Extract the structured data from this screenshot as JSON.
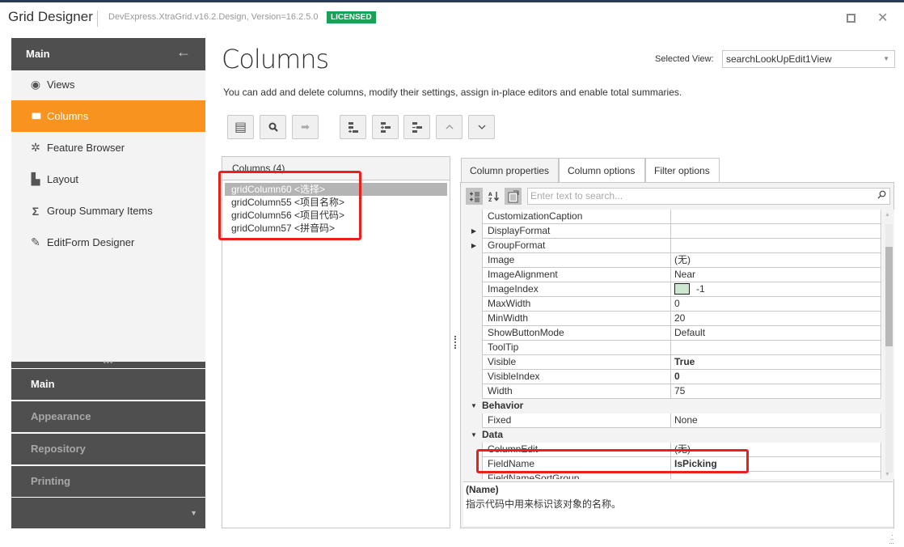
{
  "window": {
    "title": "Grid Designer",
    "version": "DevExpress.XtraGrid.v16.2.Design, Version=16.2.5.0",
    "license_badge": "LICENSED",
    "maximize_icon": "□",
    "close_icon": "✕"
  },
  "sidebar": {
    "header": "Main",
    "back_icon": "←",
    "items": [
      {
        "label": "Views",
        "icon": "eye-icon",
        "glyph": "◉"
      },
      {
        "label": "Columns",
        "icon": "columns-icon",
        "glyph": "▮▮▮",
        "active": true
      },
      {
        "label": "Feature Browser",
        "icon": "gear-icon",
        "glyph": "✲"
      },
      {
        "label": "Layout",
        "icon": "layout-icon",
        "glyph": "▙"
      },
      {
        "label": "Group Summary Items",
        "icon": "sigma-icon",
        "glyph": "Σ"
      },
      {
        "label": "EditForm Designer",
        "icon": "edit-form-icon",
        "glyph": "✎"
      }
    ],
    "splitter_dots": "•••",
    "nav_groups": [
      {
        "label": "Main",
        "current": true
      },
      {
        "label": "Appearance"
      },
      {
        "label": "Repository"
      },
      {
        "label": "Printing"
      }
    ],
    "more_arrow": "▼"
  },
  "main": {
    "title": "Columns",
    "selected_view_label": "Selected View:",
    "selected_view_value": "searchLookUpEdit1View",
    "dropdown_arrow": "▼",
    "description": "You can add and delete columns, modify their settings, assign in-place editors and enable total summaries.",
    "toolbar": [
      {
        "name": "column-list-button",
        "glyph": "▤"
      },
      {
        "name": "find-button",
        "glyph": "🔍︎",
        "alt": "⚲"
      },
      {
        "name": "retrieve-fields-button",
        "glyph": "➡",
        "disabled": true
      },
      {
        "name": "add-column-button",
        "glyph": "≛"
      },
      {
        "name": "insert-column-button",
        "glyph": "≛"
      },
      {
        "name": "remove-column-button",
        "glyph": "≡"
      },
      {
        "name": "move-up-button",
        "glyph": "⌃"
      },
      {
        "name": "move-down-button",
        "glyph": "⌄"
      }
    ]
  },
  "columns_list": {
    "header": "Columns (4)",
    "items": [
      {
        "label": "gridColumn60 <选择>",
        "selected": true
      },
      {
        "label": "gridColumn55 <项目名称>"
      },
      {
        "label": "gridColumn56 <项目代码>"
      },
      {
        "label": "gridColumn57 <拼音码>"
      }
    ]
  },
  "properties": {
    "tabs": [
      {
        "label": "Column properties",
        "active": true
      },
      {
        "label": "Column options"
      },
      {
        "label": "Filter options"
      }
    ],
    "search_placeholder": "Enter text to search...",
    "search_icon": "⌕",
    "rows": [
      {
        "name": "CustomizationCaption",
        "value": ""
      },
      {
        "name": "DisplayFormat",
        "value": "",
        "expandable": true
      },
      {
        "name": "GroupFormat",
        "value": "",
        "expandable": true
      },
      {
        "name": "Image",
        "value": "(无)"
      },
      {
        "name": "ImageAlignment",
        "value": "Near"
      },
      {
        "name": "ImageIndex",
        "value": "-1",
        "swatch_color": "#cce8cf"
      },
      {
        "name": "MaxWidth",
        "value": "0"
      },
      {
        "name": "MinWidth",
        "value": "20"
      },
      {
        "name": "ShowButtonMode",
        "value": "Default"
      },
      {
        "name": "ToolTip",
        "value": ""
      },
      {
        "name": "Visible",
        "value": "True",
        "bold": true
      },
      {
        "name": "VisibleIndex",
        "value": "0",
        "bold": true
      },
      {
        "name": "Width",
        "value": "75"
      },
      {
        "category": "Behavior"
      },
      {
        "name": "Fixed",
        "value": "None"
      },
      {
        "category": "Data"
      },
      {
        "name": "ColumnEdit",
        "value": "(无)"
      },
      {
        "name": "FieldName",
        "value": "IsPicking",
        "bold": true
      },
      {
        "name": "FieldNameSortGroup",
        "value": ""
      }
    ],
    "description_title": "(Name)",
    "description_text": "指示代码中用来标识该对象的名称。"
  },
  "colors": {
    "accent": "#f7931e",
    "sidebar_dark": "#4f4f4f",
    "license_green": "#19a155",
    "highlight_red": "#e8211b"
  }
}
